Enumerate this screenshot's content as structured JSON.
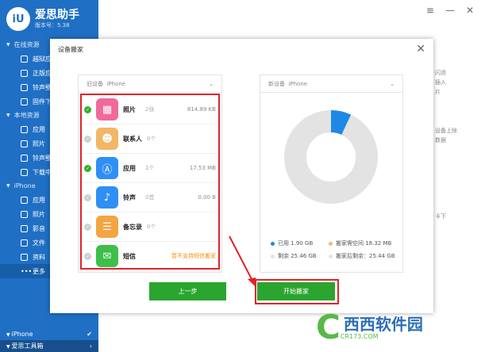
{
  "app": {
    "logo": "iU",
    "title": "爱思助手",
    "version": "版本号：5.38"
  },
  "sidebar": {
    "online": "在线资源",
    "online_items": [
      "越狱应",
      "正版应",
      "铃声壁",
      "固件下"
    ],
    "local": "本地资源",
    "local_items": [
      "应用",
      "照片",
      "铃声壁",
      "下载中"
    ],
    "iphone": "iPhone",
    "iphone_items": [
      "应用",
      "照片",
      "影音",
      "文件",
      "资料",
      "更多"
    ],
    "bottom_device": "iPhone",
    "bottom_tools": "爱思工具箱"
  },
  "bg_text": [
    "闪退",
    "插入",
    "片",
    "设备上除",
    "数据",
    "卡下"
  ],
  "dialog": {
    "title": "设备搬家",
    "old_device_label": "旧设备",
    "old_device": "iPhone",
    "new_device_label": "新设备",
    "new_device": "iPhone",
    "items": [
      {
        "name": "照片",
        "count": "2张",
        "size": "814.89 KB",
        "checked": true,
        "color": "#f06a9a",
        "icon": "photo-icon"
      },
      {
        "name": "联系人",
        "count": "0个",
        "size": "",
        "checked": false,
        "color": "#f2b766",
        "icon": "contact-icon"
      },
      {
        "name": "应用",
        "count": "1个",
        "size": "17.53 MB",
        "checked": true,
        "color": "#2f8ff5",
        "icon": "app-store-icon"
      },
      {
        "name": "铃声",
        "count": "0首",
        "size": "0.00 B",
        "checked": false,
        "color": "#2f8ff5",
        "icon": "bell-icon"
      },
      {
        "name": "备忘录",
        "count": "0个",
        "size": "",
        "checked": false,
        "color": "#f3a543",
        "icon": "notes-icon"
      },
      {
        "name": "短信",
        "count": "",
        "size": "",
        "checked": false,
        "color": "#3dbf4a",
        "icon": "message-icon",
        "warning": "暂不支持短信搬家"
      }
    ],
    "legend": {
      "used": "已用 1.90 GB",
      "required": "搬家需空间 18.32 MB",
      "remaining": "剩余 25.46 GB",
      "after": "搬家后剩余：25.44 GB"
    },
    "colors": {
      "used": "#1e88e5",
      "required": "#f7b77a",
      "remaining": "#e3e3e3"
    },
    "storage_fraction_used": 0.07,
    "prev_button": "上一步",
    "start_button": "开始搬家"
  },
  "watermark": {
    "logo": "C",
    "text": "西西软件园",
    "sub": "CR173.COM"
  }
}
